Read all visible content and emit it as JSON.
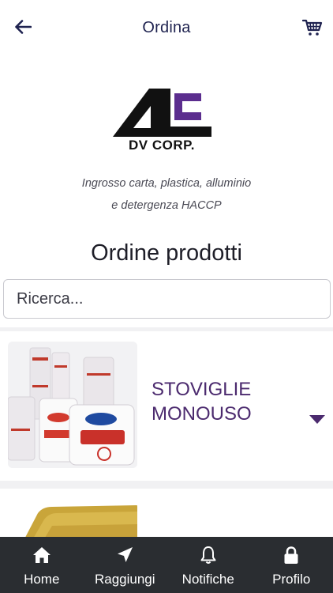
{
  "header": {
    "title": "Ordina",
    "back_icon": "arrow-left-icon",
    "cart_icon": "cart-icon"
  },
  "logo": {
    "brand": "DV CORP."
  },
  "tagline": {
    "line1": "Ingrosso carta, plastica, alluminio",
    "line2": "e detergenza HACCP"
  },
  "section_title": "Ordine prodotti",
  "search": {
    "placeholder": "Ricerca...",
    "value": ""
  },
  "categories": [
    {
      "label": "STOVIGLIE MONOUSO",
      "expand_icon": "caret-down-icon"
    },
    {
      "label": ""
    }
  ],
  "tabbar": {
    "items": [
      {
        "label": "Home",
        "icon": "home-icon"
      },
      {
        "label": "Raggiungi",
        "icon": "navigation-icon"
      },
      {
        "label": "Notifiche",
        "icon": "bell-icon"
      },
      {
        "label": "Profilo",
        "icon": "lock-icon"
      }
    ]
  },
  "colors": {
    "accent": "#4b2a6e",
    "navy": "#1f2350",
    "tabbar": "#2a2d31",
    "list_bg": "#f1f1f3"
  }
}
